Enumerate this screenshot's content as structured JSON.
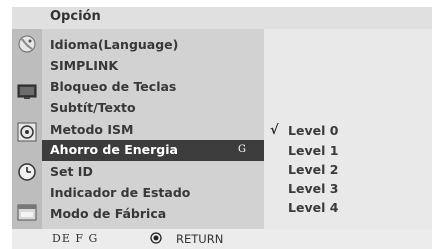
{
  "menu": {
    "title": "Opción",
    "items": [
      {
        "label": "Idioma(Language)"
      },
      {
        "label": "SIMPLINK"
      },
      {
        "label": "Bloqueo de Teclas"
      },
      {
        "label": "Subtít/Texto"
      },
      {
        "label": "Metodo ISM"
      },
      {
        "label": "Ahorro de Energia",
        "hint": "G"
      },
      {
        "label": "Set ID"
      },
      {
        "label": "Indicador de Estado"
      },
      {
        "label": "Modo de Fábrica"
      }
    ]
  },
  "submenu": {
    "check_mark": "√",
    "options": [
      "Level 0",
      "Level 1",
      "Level 2",
      "Level 3",
      "Level 4"
    ]
  },
  "side_icons": [
    "satellite-dish-icon",
    "monitor-icon",
    "disc-icon",
    "clock-icon",
    "calendar-icon"
  ],
  "footer": {
    "nav_hint": "DE  F G",
    "return_label": "RETURN"
  }
}
